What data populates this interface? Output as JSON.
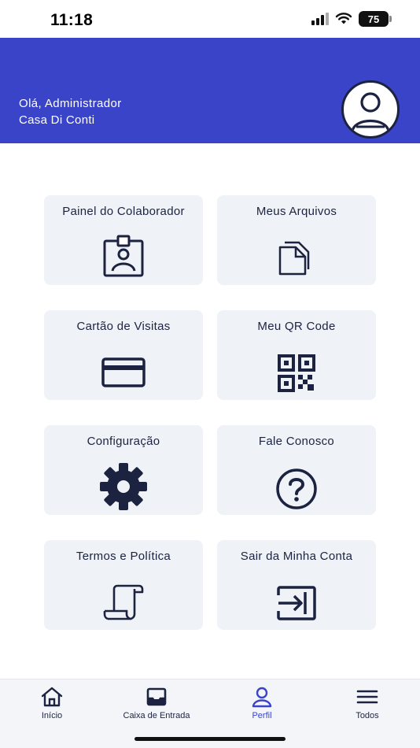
{
  "status": {
    "time": "11:18",
    "battery": "75",
    "icons": [
      "signal-icon",
      "wifi-icon",
      "battery-icon"
    ]
  },
  "header": {
    "greeting": "Olá, Administrador",
    "company": "Casa Di Conti",
    "avatar_icon": "user-icon",
    "background": "#3a44c9"
  },
  "cards": [
    {
      "label": "Painel do Colaborador",
      "icon": "id-badge-icon"
    },
    {
      "label": "Meus Arquivos",
      "icon": "files-icon"
    },
    {
      "label": "Cartão de Visitas",
      "icon": "credit-card-icon"
    },
    {
      "label": "Meu QR Code",
      "icon": "qr-code-icon"
    },
    {
      "label": "Configuração",
      "icon": "gear-icon"
    },
    {
      "label": "Fale Conosco",
      "icon": "question-icon"
    },
    {
      "label": "Termos e Política",
      "icon": "scroll-icon"
    },
    {
      "label": "Sair da Minha Conta",
      "icon": "sign-out-icon"
    }
  ],
  "nav": {
    "items": [
      {
        "label": "Início",
        "icon": "home-icon"
      },
      {
        "label": "Caixa de Entrada",
        "icon": "inbox-icon"
      },
      {
        "label": "Perfil",
        "icon": "user-icon"
      },
      {
        "label": "Todos",
        "icon": "menu-icon"
      }
    ],
    "active": "Perfil"
  },
  "colors": {
    "accent": "#3a44c9",
    "card_bg": "#eff2f7",
    "icon": "#1c2340"
  }
}
